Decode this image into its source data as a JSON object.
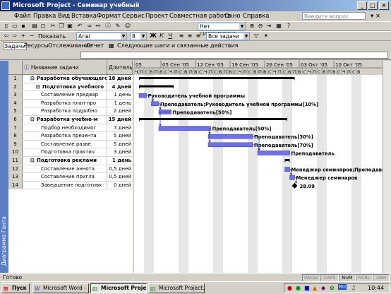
{
  "window": {
    "title": "Microsoft Project - Семинар учебный"
  },
  "menu": [
    "Файл",
    "Правка",
    "Вид",
    "Вставка",
    "Формат",
    "Сервис",
    "Проект",
    "Совместная работа",
    "Окно",
    "Справка"
  ],
  "question_placeholder": "Введите вопрос",
  "toolbar": {
    "group_combo": "Нет группировки",
    "show_label": "Показать",
    "font_combo": "Arial",
    "size_combo": "8",
    "filter_combo": "Все задачи"
  },
  "viewbar": {
    "items": [
      "Задачи",
      "Ресурсы",
      "Отслеживание",
      "Отчет"
    ],
    "next_steps": "Следующие шаги и связанные действия"
  },
  "side_view_label": "Диаграмма Ганта",
  "table": {
    "col_name": "Название задачи",
    "col_duration": "Длительность",
    "rows": [
      {
        "id": "1",
        "name": "Разработка обучающего",
        "duration": "18 дней",
        "summary": true,
        "indent": 0
      },
      {
        "id": "2",
        "name": "Подготовка учебного",
        "duration": "4 дней",
        "summary": true,
        "indent": 1
      },
      {
        "id": "3",
        "name": "Составление предвар",
        "duration": "1 день",
        "summary": false,
        "indent": 2
      },
      {
        "id": "4",
        "name": "Разработка план-про",
        "duration": "1 день",
        "summary": false,
        "indent": 2
      },
      {
        "id": "5",
        "name": "Разработка подробно",
        "duration": "2 дней",
        "summary": false,
        "indent": 2
      },
      {
        "id": "6",
        "name": "Разработка учебно-м",
        "duration": "15 дней",
        "summary": true,
        "indent": 0
      },
      {
        "id": "7",
        "name": "Подбор необходимог",
        "duration": "7 дней",
        "summary": false,
        "indent": 2
      },
      {
        "id": "8",
        "name": "Разработка презента",
        "duration": "5 дней",
        "summary": false,
        "indent": 2
      },
      {
        "id": "9",
        "name": "Составление разве",
        "duration": "5 дней",
        "summary": false,
        "indent": 2
      },
      {
        "id": "10",
        "name": "Подготовка практич",
        "duration": "3 дней",
        "summary": false,
        "indent": 2
      },
      {
        "id": "11",
        "name": "Подготовка реклами",
        "duration": "1 день",
        "summary": true,
        "indent": 0
      },
      {
        "id": "12",
        "name": "Составление аннота",
        "duration": "0,5 дней",
        "summary": false,
        "indent": 2
      },
      {
        "id": "13",
        "name": "Составление пригла",
        "duration": "0,5 дней",
        "summary": false,
        "indent": 2
      },
      {
        "id": "14",
        "name": "Завершение подготовк",
        "duration": "0 дней",
        "summary": false,
        "indent": 2
      }
    ]
  },
  "timescale": {
    "weeks": [
      "05",
      "05 Сен '05",
      "12 Сен '05",
      "19 Сен '05",
      "26 Сен '05",
      "03 Окт '05",
      "10 Окт '05"
    ],
    "days": [
      "Ч",
      "П",
      "С",
      "В",
      "П",
      "В",
      "С",
      "Ч",
      "П",
      "С",
      "В",
      "П",
      "В",
      "С",
      "Ч",
      "П",
      "С",
      "В",
      "П",
      "В",
      "С",
      "Ч",
      "П",
      "С",
      "В",
      "П",
      "В",
      "С",
      "Ч",
      "П",
      "С",
      "В",
      "П",
      "В",
      "С",
      "Ч",
      "П",
      "С",
      "В",
      "П",
      "В",
      "С",
      "Ч",
      "П",
      "С",
      "В"
    ]
  },
  "bar_labels": [
    "Руководитель учебной программы",
    "Преподаватель;Руководитель учебной программы[10%]",
    "Преподаватель[50%]",
    "Преподаватель[50%]",
    "Преподаватель[30%]",
    "Преподаватель[70%]",
    "Преподаватель",
    "Менеджер семинаров;Преподават",
    "Менеджер семинаров",
    "28.09"
  ],
  "status": {
    "ready": "Готово",
    "indicators": [
      "РАСШ",
      "CAPS",
      "NUM",
      "SCRL",
      "ЗАМ"
    ]
  },
  "taskbar": {
    "start": "Пуск",
    "buttons": [
      "Microsoft Word - ...",
      "Microsoft Project...",
      "Microsoft Project..."
    ],
    "clock": "10:44",
    "lang": "RU"
  },
  "colors": {
    "title_start": "#0a246a",
    "title_end": "#a6caf0",
    "bar": "#6f6ff0",
    "summary": "#000000",
    "sidebar": "#5b7ec5"
  }
}
